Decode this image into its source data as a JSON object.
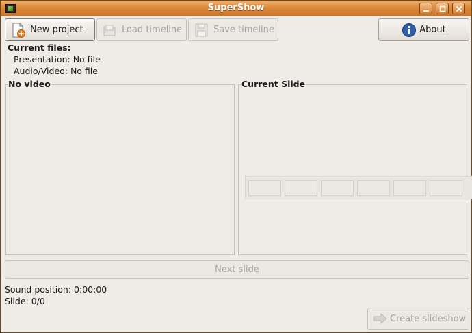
{
  "window": {
    "title": "SuperShow"
  },
  "toolbar": {
    "new_project": "New project",
    "load_timeline": "Load timeline",
    "save_timeline": "Save timeline",
    "about": "About",
    "icons": {
      "new_project": "new-document-icon",
      "load_timeline": "open-icon",
      "save_timeline": "save-icon",
      "about": "info-icon"
    }
  },
  "current_files": {
    "heading": "Current files:",
    "presentation": "Presentation: No file",
    "audio_video": "Audio/Video: No file"
  },
  "panels": {
    "video_label": "No video",
    "slide_label": "Current Slide"
  },
  "next_slide": "Next slide",
  "status": {
    "sound_position": "Sound position: 0:00:00",
    "slide": "Slide: 0/0"
  },
  "create_slideshow": "Create slideshow",
  "colors": {
    "titlebar": "#dd8a3c",
    "window_bg": "#efebe7",
    "disabled_text": "#a7a39d"
  }
}
